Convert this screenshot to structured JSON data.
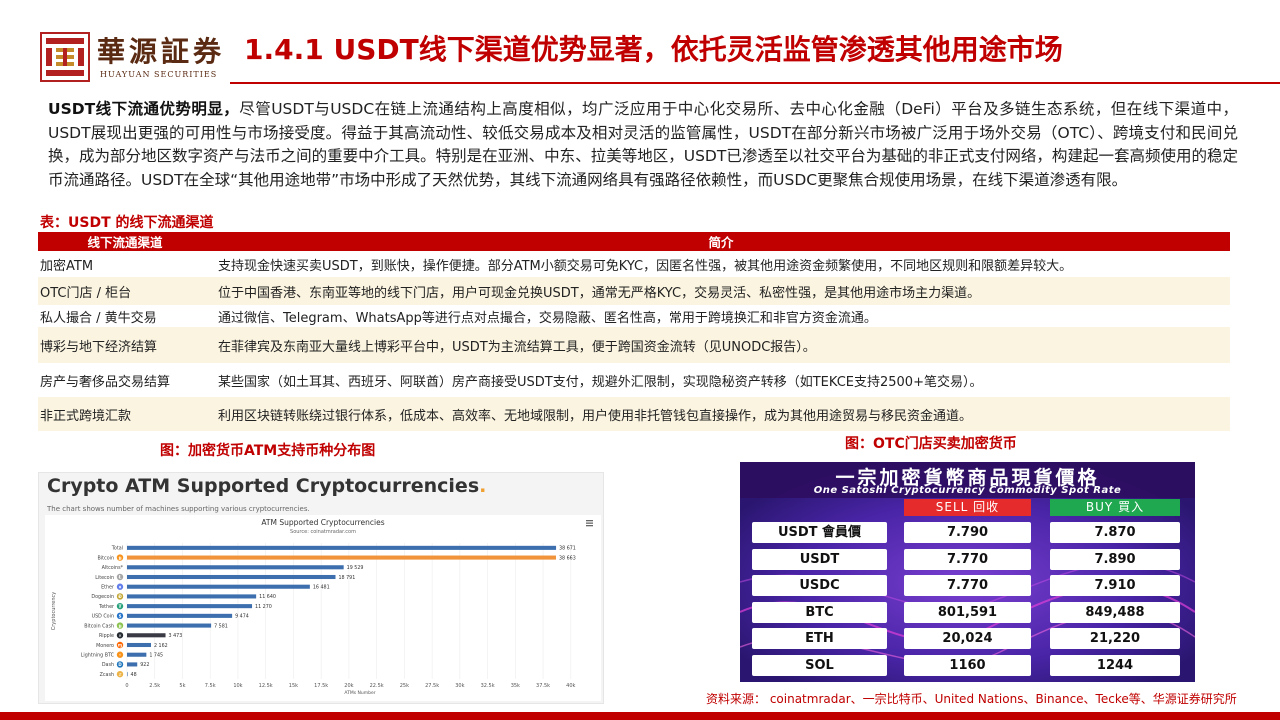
{
  "header": {
    "logo_cn": "華源証券",
    "logo_en": "HUAYUAN SECURITIES",
    "title": "1.4.1 USDT线下渠道优势显著，依托灵活监管渗透其他用途市场"
  },
  "intro": {
    "lead": "USDT线下流通优势明显，",
    "body": "尽管USDT与USDC在链上流通结构上高度相似，均广泛应用于中心化交易所、去中心化金融（DeFi）平台及多链生态系统，但在线下渠道中，USDT展现出更强的可用性与市场接受度。得益于其高流动性、较低交易成本及相对灵活的监管属性，USDT在部分新兴市场被广泛用于场外交易（OTC）、跨境支付和民间兑换，成为部分地区数字资产与法币之间的重要中介工具。特别是在亚洲、中东、拉美等地区，USDT已渗透至以社交平台为基础的非正式支付网络，构建起一套高频使用的稳定币流通路径。USDT在全球“其他用途地带”市场中形成了天然优势，其线下流通网络具有强路径依赖性，而USDC更聚焦合规使用场景，在线下渠道渗透有限。"
  },
  "table": {
    "caption": "表：USDT 的线下流通渠道",
    "headers": [
      "线下流通渠道",
      "简介"
    ],
    "rows": [
      {
        "channel": "加密ATM",
        "desc": "支持现金快速买卖USDT，到账快，操作便捷。部分ATM小额交易可免KYC，因匿名性强，被其他用途资金频繁使用，不同地区规则和限额差异较大。"
      },
      {
        "channel": "OTC门店 / 柜台",
        "desc": "位于中国香港、东南亚等地的线下门店，用户可现金兑换USDT，通常无严格KYC，交易灵活、私密性强，是其他用途市场主力渠道。"
      },
      {
        "channel": "私人撮合 / 黄牛交易",
        "desc": "通过微信、Telegram、WhatsApp等进行点对点撮合，交易隐蔽、匿名性高，常用于跨境换汇和非官方资金流通。"
      },
      {
        "channel": "博彩与地下经济结算",
        "desc": "在菲律宾及东南亚大量线上博彩平台中，USDT为主流结算工具，便于跨国资金流转（见UNODC报告）。"
      },
      {
        "channel": "房产与奢侈品交易结算",
        "desc": "某些国家（如土耳其、西班牙、阿联酋）房产商接受USDT支付，规避外汇限制，实现隐秘资产转移（如TEKCE支持2500+笔交易）。"
      },
      {
        "channel": "非正式跨境汇款",
        "desc": "利用区块链转账绕过银行体系，低成本、高效率、无地域限制，用户使用非托管钱包直接操作，成为其他用途贸易与移民资金通道。"
      }
    ]
  },
  "figures": {
    "left_caption": "图：加密货币ATM支持币种分布图",
    "right_caption": "图：OTC门店买卖加密货币"
  },
  "atm_chart": {
    "heading": "Crypto ATM Supported Cryptocurrencies",
    "heading_dot": ".",
    "subtitle": "The chart shows number of machines supporting various cryptocurrencies.",
    "menu_icon": "menu-icon",
    "bar_color": "#3d6fae",
    "accent_color": "#f0933a",
    "dark_color": "#3a3a44",
    "chart_data": {
      "type": "bar",
      "orientation": "horizontal",
      "title": "ATM Supported Cryptocurrencies",
      "subtitle": "Source: coinatmradar.com",
      "xlabel": "ATMs Number",
      "ylabel": "Cryptocurrency",
      "xlim": [
        0,
        42000
      ],
      "xticks": [
        "0",
        "2.5k",
        "5k",
        "7.5k",
        "10k",
        "12.5k",
        "15k",
        "17.5k",
        "20k",
        "22.5k",
        "25k",
        "27.5k",
        "30k",
        "32.5k",
        "35k",
        "37.5k",
        "40k",
        "42..."
      ],
      "categories": [
        "Total",
        "Bitcoin",
        "Altcoins*",
        "Litecoin",
        "Ether",
        "Dogecoin",
        "Tether",
        "USD Coin",
        "Bitcoin Cash",
        "Ripple",
        "Monero",
        "Lightning BTC",
        "Dash",
        "Zcash"
      ],
      "values": [
        38671,
        38663,
        19529,
        18791,
        16481,
        11640,
        11270,
        9474,
        7581,
        3473,
        2162,
        1745,
        922,
        48
      ],
      "labels": [
        "38 671",
        "38 663",
        "19 529",
        "18 791",
        "16 481",
        "11 640",
        "11 270",
        "9 474",
        "7 581",
        "3 473",
        "2 162",
        "1 745",
        "922",
        "48"
      ],
      "colors": [
        "#3d6fae",
        "#f0933a",
        "#3d6fae",
        "#3d6fae",
        "#3d6fae",
        "#3d6fae",
        "#3d6fae",
        "#3d6fae",
        "#3d6fae",
        "#3a3a44",
        "#3d6fae",
        "#3d6fae",
        "#3d6fae",
        "#3d6fae"
      ],
      "icon_colors": [
        "",
        "#f7931a",
        "",
        "#a5a5a5",
        "#627eea",
        "#c2a633",
        "#26a17b",
        "#2775ca",
        "#8dc351",
        "#23292f",
        "#ff6600",
        "#f7931a",
        "#1c75bc",
        "#ecb244"
      ],
      "icon_glyphs": [
        "",
        "₿",
        "",
        "Ł",
        "♦",
        "Ð",
        "₮",
        "$",
        "₿",
        "✕",
        "ɱ",
        "⚡",
        "D",
        "ℤ"
      ]
    }
  },
  "otc_board": {
    "title_cn": "一宗加密貨幣商品現貨價格",
    "title_en": "One Satoshi Cryptocurrency Commodity Spot Rate",
    "sell_label": "SELL 回收",
    "buy_label": "BUY 買入",
    "sell_color": "#e52b2b",
    "buy_color": "#1fa84f",
    "rows": [
      {
        "name": "USDT 會員價",
        "sell": "7.790",
        "buy": "7.870"
      },
      {
        "name": "USDT",
        "sell": "7.770",
        "buy": "7.890"
      },
      {
        "name": "USDC",
        "sell": "7.770",
        "buy": "7.910"
      },
      {
        "name": "BTC",
        "sell": "801,591",
        "buy": "849,488"
      },
      {
        "name": "ETH",
        "sell": "20,024",
        "buy": "21,220"
      },
      {
        "name": "SOL",
        "sell": "1160",
        "buy": "1244"
      }
    ]
  },
  "source": "资料来源： coinatmradar、一宗比特币、United Nations、Binance、Tecke等、华源证券研究所",
  "brand_color": "#c00000"
}
